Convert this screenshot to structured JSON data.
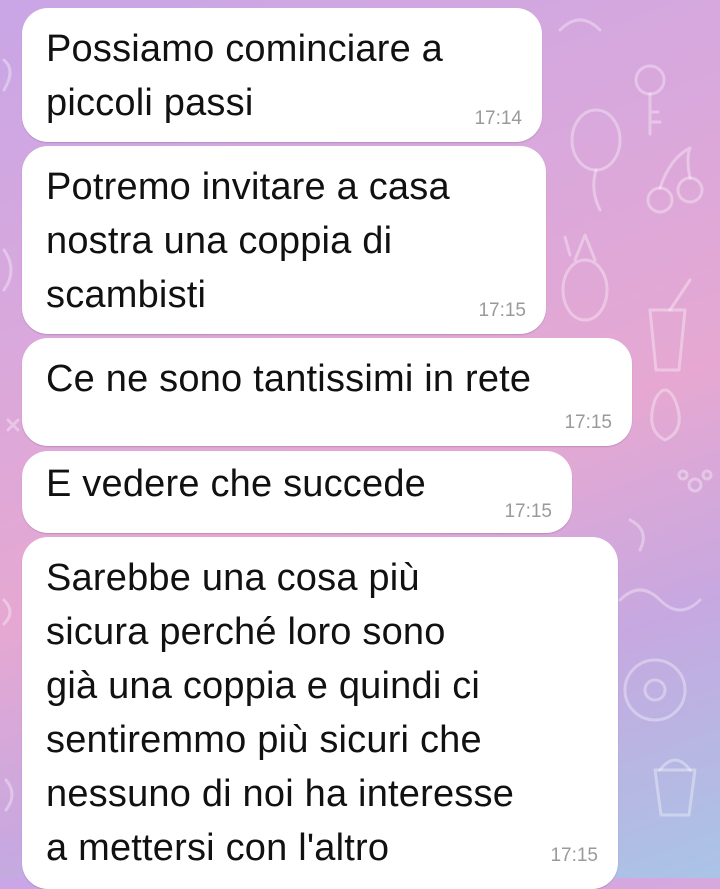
{
  "messages": [
    {
      "text": "Possiamo cominciare a\npiccoli passi",
      "time": "17:14"
    },
    {
      "text": "Potremo invitare a casa\nnostra una coppia di\nscambisti",
      "time": "17:15"
    },
    {
      "text": "Ce ne sono tantissimi in rete",
      "time": "17:15"
    },
    {
      "text": "E vedere che succede",
      "time": "17:15"
    },
    {
      "text": "Sarebbe una cosa più\nsicura perché loro sono\ngià una coppia e quindi ci\nsentiremmo più sicuri che\nnessuno di noi ha interesse\na mettersi con l'altro",
      "time": "17:15"
    }
  ],
  "theme": {
    "bubble_color": "#ffffff",
    "time_color": "#9a9a9a",
    "wallpaper_colors": [
      "#c9a6e6",
      "#e6a8d2",
      "#a9c4e6"
    ]
  }
}
